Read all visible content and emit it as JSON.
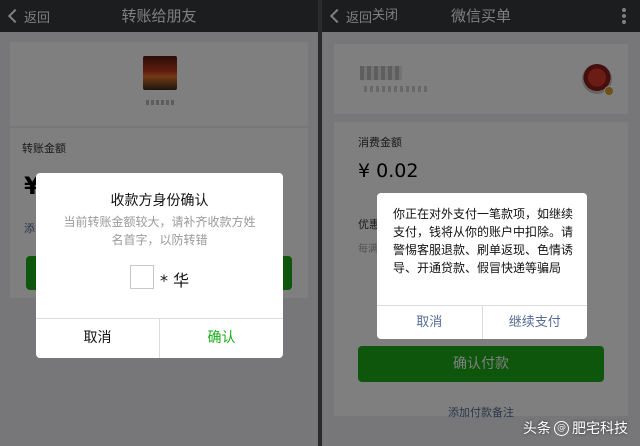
{
  "left": {
    "nav": {
      "back_label": "返回",
      "title": "转账给朋友"
    },
    "amount_label": "转账金额",
    "currency_symbol": "¥",
    "note_partial": "添",
    "dialog": {
      "title": "收款方身份确认",
      "message": "当前转账金额较大，请补齐收款方姓名首字，以防转错",
      "name_suffix": "* 华",
      "cancel_label": "取消",
      "confirm_label": "确认"
    }
  },
  "right": {
    "nav": {
      "back_label": "返回",
      "close_label": "关闭",
      "title": "微信买单"
    },
    "amount_label": "消费金额",
    "amount_value": "¥ 0.02",
    "discount_partial": "优惠",
    "discount_sub_partial": "每满",
    "dialog": {
      "message": "你正在对外支付一笔款项，如继续支付，钱将从你的账户中扣除。请警惕客服退款、刷单返现、色情诱导、开通贷款、假冒快递等骗局",
      "cancel_label": "取消",
      "continue_label": "继续支付"
    },
    "confirm_pay_label": "确认付款",
    "add_note_label": "添加付款备注"
  },
  "watermark": {
    "prefix": "头条",
    "at": "@",
    "name": "肥宅科技"
  },
  "colors": {
    "nav_bg": "#393a3f",
    "green": "#1aad19",
    "link_blue": "#576b95",
    "bg": "#efeff4"
  }
}
